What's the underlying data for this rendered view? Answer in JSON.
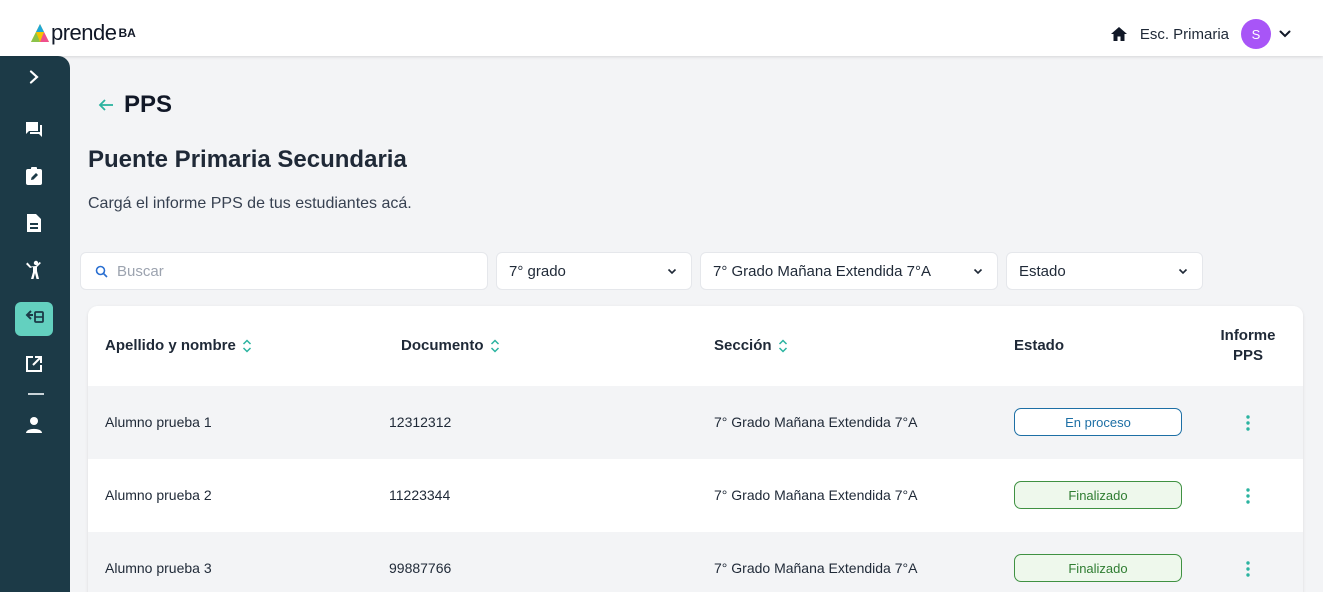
{
  "header": {
    "logo_text": "prende",
    "logo_suffix": "BA",
    "school": "Esc. Primaria",
    "avatar_initial": "S"
  },
  "sidebar": {
    "items": [
      {
        "icon": "chevron-right-icon",
        "active": false
      },
      {
        "icon": "chat-icon",
        "active": false
      },
      {
        "icon": "clipboard-edit-icon",
        "active": false
      },
      {
        "icon": "document-icon",
        "active": false
      },
      {
        "icon": "person-activity-icon",
        "active": false
      },
      {
        "icon": "transfer-icon",
        "active": true
      },
      {
        "icon": "external-link-icon",
        "active": false
      },
      {
        "icon": "user-icon",
        "active": false
      }
    ]
  },
  "breadcrumb": {
    "title": "PPS"
  },
  "page": {
    "title": "Puente Primaria Secundaria",
    "subtitle": "Cargá el informe PPS de tus estudiantes acá."
  },
  "filters": {
    "search_placeholder": "Buscar",
    "grade": "7° grado",
    "section": "7° Grado Mañana Extendida 7°A",
    "status": "Estado"
  },
  "table": {
    "headers": {
      "name": "Apellido y nombre",
      "document": "Documento",
      "section": "Sección",
      "status": "Estado",
      "report_line1": "Informe",
      "report_line2": "PPS"
    },
    "rows": [
      {
        "name": "Alumno prueba 1",
        "document": "12312312",
        "section": "7° Grado Mañana Extendida 7°A",
        "status": "En proceso"
      },
      {
        "name": "Alumno prueba 2",
        "document": "11223344",
        "section": "7° Grado Mañana Extendida 7°A",
        "status": "Finalizado"
      },
      {
        "name": "Alumno prueba 3",
        "document": "99887766",
        "section": "7° Grado Mañana Extendida 7°A",
        "status": "Finalizado"
      }
    ]
  },
  "colors": {
    "sidebar_bg": "#1c3a47",
    "accent": "#63d0bf",
    "avatar": "#a855f7",
    "status_in_progress": "#1d6fa5",
    "status_done": "#3f9142"
  }
}
